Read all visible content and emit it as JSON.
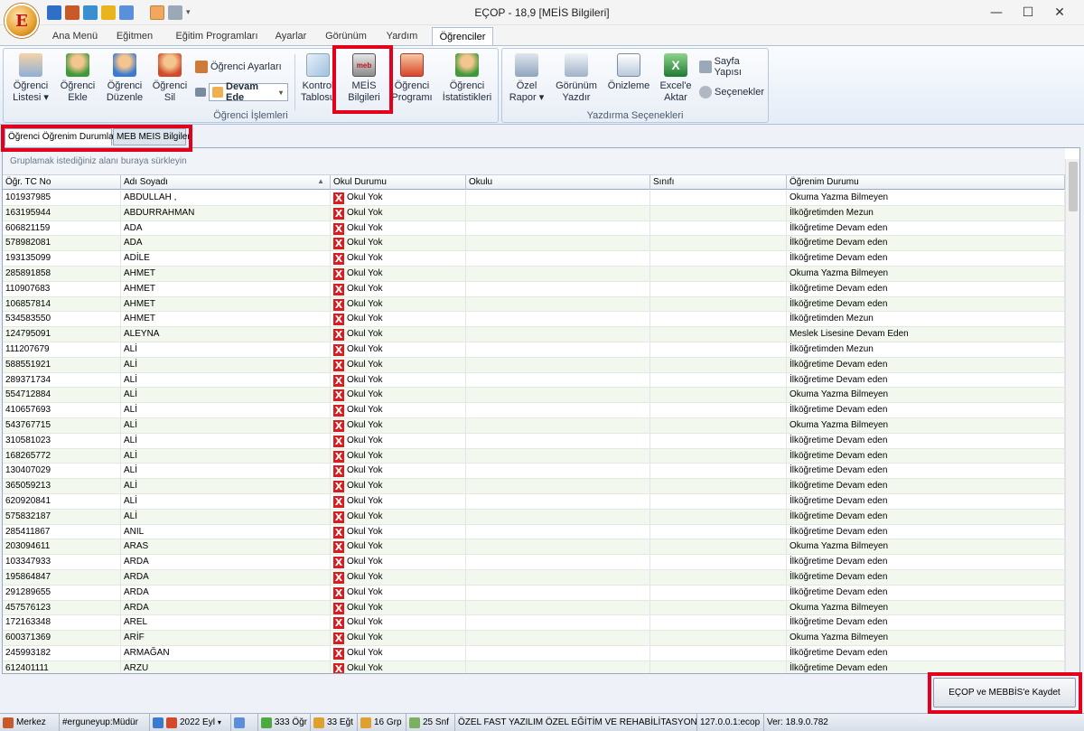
{
  "window": {
    "title": "EÇOP - 18,9 [MEİS Bilgileri]",
    "minimize": "—",
    "maximize": "☐",
    "close": "✕",
    "orb_letter": "E"
  },
  "ribbon_tabs": [
    "Ana Menü",
    "Eğitmen",
    "Eğitim Programları",
    "Ayarlar",
    "Görünüm",
    "Yardım",
    "Öğrenciler"
  ],
  "ribbon": {
    "ogrenci_islemleri_label": "Öğrenci İşlemleri",
    "yazdirma_label": "Yazdırma Seçenekleri",
    "ogrenci_listesi": [
      "Öğrenci",
      "Listesi ▾"
    ],
    "ogrenci_ekle": [
      "Öğrenci",
      "Ekle"
    ],
    "ogrenci_duzenle": [
      "Öğrenci",
      "Düzenle"
    ],
    "ogrenci_sil": [
      "Öğrenci",
      "Sil"
    ],
    "ogrenci_ayarlari": "Öğrenci Ayarları",
    "devam_select": "Devam Ede",
    "kontrol_tablosu": [
      "Kontrol",
      "Tablosu"
    ],
    "meis_bilgileri": [
      "MEİS",
      "Bilgileri"
    ],
    "ogrenci_programi": [
      "Öğrenci",
      "Programı"
    ],
    "ogrenci_istatistikleri": [
      "Öğrenci",
      "İstatistikleri"
    ],
    "ozel_rapor": [
      "Özel",
      "Rapor ▾"
    ],
    "gorunum_yazdir": [
      "Görünüm",
      "Yazdır"
    ],
    "onizleme": "Önizleme",
    "excele_aktar": [
      "Excel'e",
      "Aktar"
    ],
    "sayfa_yapisi": "Sayfa Yapısı",
    "secenekler": "Seçenekler"
  },
  "doc_tabs": [
    "Öğrenci Öğrenim Durumları",
    "MEB MEIS Bilgileri"
  ],
  "grid": {
    "group_hint": "Gruplamak istediğiniz alanı buraya sürkleyin",
    "columns": [
      "Öğr. TC No",
      "Adı Soyadı",
      "Okul Durumu",
      "Okulu",
      "Sınıfı",
      "Öğrenim Durumu"
    ],
    "sort_indicator": "▲",
    "rows": [
      [
        "101937985",
        "ABDULLAH ,",
        "Okul Yok",
        "",
        "",
        "Okuma Yazma Bilmeyen"
      ],
      [
        "163195944",
        "ABDURRAHMAN",
        "Okul Yok",
        "",
        "",
        "İlköğretimden Mezun"
      ],
      [
        "606821159",
        "ADA",
        "Okul Yok",
        "",
        "",
        "İlköğretime Devam eden"
      ],
      [
        "578982081",
        "ADA",
        "Okul Yok",
        "",
        "",
        "İlköğretime Devam eden"
      ],
      [
        "193135099",
        "ADİLE",
        "Okul Yok",
        "",
        "",
        "İlköğretime Devam eden"
      ],
      [
        "285891858",
        "AHMET",
        "Okul Yok",
        "",
        "",
        "Okuma Yazma Bilmeyen"
      ],
      [
        "110907683",
        "AHMET",
        "Okul Yok",
        "",
        "",
        "İlköğretime Devam eden"
      ],
      [
        "106857814",
        "AHMET",
        "Okul Yok",
        "",
        "",
        "İlköğretime Devam eden"
      ],
      [
        "534583550",
        "AHMET",
        "Okul Yok",
        "",
        "",
        "İlköğretimden Mezun"
      ],
      [
        "124795091",
        "ALEYNA",
        "Okul Yok",
        "",
        "",
        "Meslek Lisesine Devam Eden"
      ],
      [
        "111207679",
        "ALİ",
        "Okul Yok",
        "",
        "",
        "İlköğretimden Mezun"
      ],
      [
        "588551921",
        "ALİ",
        "Okul Yok",
        "",
        "",
        "İlköğretime Devam eden"
      ],
      [
        "289371734",
        "ALİ",
        "Okul Yok",
        "",
        "",
        "İlköğretime Devam eden"
      ],
      [
        "554712884",
        "ALİ",
        "Okul Yok",
        "",
        "",
        "Okuma Yazma Bilmeyen"
      ],
      [
        "410657693",
        "ALİ",
        "Okul Yok",
        "",
        "",
        "İlköğretime Devam eden"
      ],
      [
        "543767715",
        "ALİ",
        "Okul Yok",
        "",
        "",
        "Okuma Yazma Bilmeyen"
      ],
      [
        "310581023",
        "ALİ",
        "Okul Yok",
        "",
        "",
        "İlköğretime Devam eden"
      ],
      [
        "168265772",
        "ALİ",
        "Okul Yok",
        "",
        "",
        "İlköğretime Devam eden"
      ],
      [
        "130407029",
        "ALİ",
        "Okul Yok",
        "",
        "",
        "İlköğretime Devam eden"
      ],
      [
        "365059213",
        "ALİ",
        "Okul Yok",
        "",
        "",
        "İlköğretime Devam eden"
      ],
      [
        "620920841",
        "ALİ",
        "Okul Yok",
        "",
        "",
        "İlköğretime Devam eden"
      ],
      [
        "575832187",
        "ALİ",
        "Okul Yok",
        "",
        "",
        "İlköğretime Devam eden"
      ],
      [
        "285411867",
        "ANIL",
        "Okul Yok",
        "",
        "",
        "İlköğretime Devam eden"
      ],
      [
        "203094611",
        "ARAS",
        "Okul Yok",
        "",
        "",
        "Okuma Yazma Bilmeyen"
      ],
      [
        "103347933",
        "ARDA",
        "Okul Yok",
        "",
        "",
        "İlköğretime Devam eden"
      ],
      [
        "195864847",
        "ARDA",
        "Okul Yok",
        "",
        "",
        "İlköğretime Devam eden"
      ],
      [
        "291289655",
        "ARDA",
        "Okul Yok",
        "",
        "",
        "İlköğretime Devam eden"
      ],
      [
        "457576123",
        "ARDA",
        "Okul Yok",
        "",
        "",
        "Okuma Yazma Bilmeyen"
      ],
      [
        "172163348",
        "AREL",
        "Okul Yok",
        "",
        "",
        "İlköğretime Devam eden"
      ],
      [
        "600371369",
        "ARİF",
        "Okul Yok",
        "",
        "",
        "Okuma Yazma Bilmeyen"
      ],
      [
        "245993182",
        "ARMAĞAN",
        "Okul Yok",
        "",
        "",
        "İlköğretime Devam eden"
      ],
      [
        "612401111",
        "ARZU",
        "Okul Yok",
        "",
        "",
        "İlköğretime Devam eden"
      ]
    ]
  },
  "save_button": "EÇOP ve MEBBİS'e Kaydet",
  "status": {
    "merkez": "Merkez",
    "user": "#erguneyup:Müdür",
    "period": "2022 Eyl",
    "ogr": "333 Öğr",
    "egt": "33 Eğt",
    "grp": "16 Grp",
    "snf": "25 Snf",
    "institution": "ÖZEL FAST YAZILIM ÖZEL EĞİTİM VE REHABİLİTASYON...",
    "server": "127.0.0.1:ecop",
    "version": "Ver: 18.9.0.782"
  }
}
